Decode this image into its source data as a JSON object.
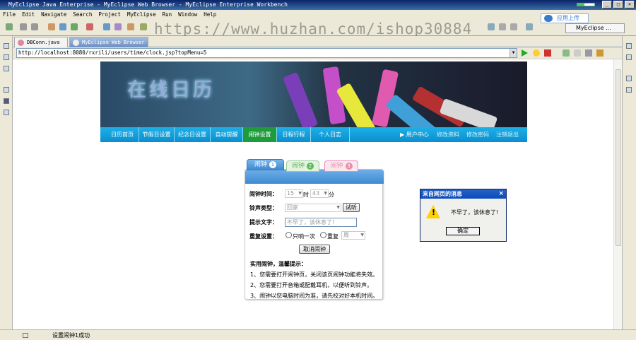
{
  "window": {
    "title": "MyEclipse Java Enterprise - MyEclipse Web Browser - MyEclipse Enterprise Workbench"
  },
  "menu": [
    "File",
    "Edit",
    "Navigate",
    "Search",
    "Project",
    "MyEclipse",
    "Run",
    "Window",
    "Help"
  ],
  "cloud_upload": "应用上传",
  "perspective": "MyEclipse ...",
  "watermark": "https://www.huzhan.com/ishop30884",
  "tabs": [
    {
      "label": "DBConn.java"
    },
    {
      "label": "MyEclipse Web Browser"
    }
  ],
  "url": "http://localhost:8080/rxrili/users/time/clock.jsp?topMenu=5",
  "banner_title": "在线日历",
  "nav": {
    "items": [
      "日历首页",
      "节假日设置",
      "纪念日设置",
      "自动提醒",
      "闹钟设置",
      "日程行程",
      "个人日志"
    ],
    "active": "闹钟设置",
    "user": [
      "用户中心",
      "修改资料",
      "修改密码",
      "注销退出"
    ]
  },
  "alarm": {
    "tabs": [
      {
        "label": "闹钟",
        "num": "1"
      },
      {
        "label": "闹钟",
        "num": "2"
      },
      {
        "label": "闹钟",
        "num": "3"
      }
    ],
    "time_label": "闹钟时间：",
    "hour": "15",
    "hour_unit": "时",
    "minute": "43",
    "minute_unit": "分",
    "sound_label": "铃声类型：",
    "sound": "回家",
    "listen_button": "试听",
    "text_label": "提示文字：",
    "text_value": "不早了，该休息了!",
    "repeat_label": "重复设置：",
    "once": "只响一次",
    "repeat": "重复",
    "repeat_select": "周",
    "cancel_button": "取消闹钟",
    "tips_title": "实用闹钟，温馨提示：",
    "tips": [
      "1、您需要打开闹钟页，关闭该页闹钟功能将失效。",
      "2、您需要打开音箱或配戴耳机，以便听到铃声。",
      "3、闹钟以您电脑时间为准，请先校对好本机时间。"
    ]
  },
  "dialog": {
    "title": "来自网页的消息",
    "message": "不早了，该休息了!",
    "ok": "确定"
  },
  "status": "设置闹钟1成功"
}
